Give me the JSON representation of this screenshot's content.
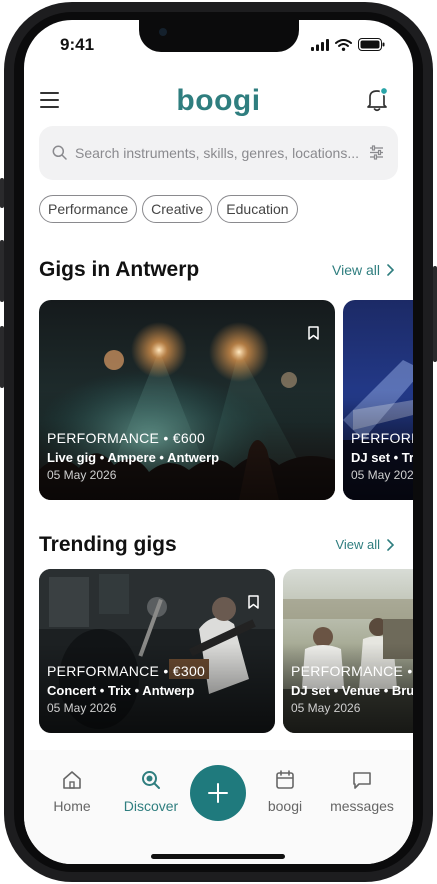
{
  "status_bar": {
    "time": "9:41"
  },
  "header": {
    "logo": "boogi"
  },
  "search": {
    "placeholder": "Search instruments, skills, genres, locations..."
  },
  "chips": [
    "Performance",
    "Creative",
    "Education"
  ],
  "sections": {
    "antwerp": {
      "title": "Gigs in Antwerp",
      "view_all": "View all",
      "cards": [
        {
          "category": "PERFORMANCE • €600",
          "details": "Live gig • Ampere • Antwerp",
          "date": "05 May 2026"
        },
        {
          "category": "PERFORM",
          "details": "DJ set • Tr",
          "date": "05 May 202"
        }
      ]
    },
    "trending": {
      "title": "Trending gigs",
      "view_all": "View all",
      "cards": [
        {
          "category": "PERFORMANCE • €300",
          "details": "Concert • Trix • Antwerp",
          "date": "05 May 2026"
        },
        {
          "category": "PERFORMANCE • €",
          "details": "DJ set • Venue • Brus",
          "date": "05 May 2026"
        }
      ]
    }
  },
  "nav": {
    "items": [
      {
        "label": "Home",
        "icon": "home-icon"
      },
      {
        "label": "Discover",
        "icon": "discover-icon",
        "active": true
      },
      {
        "label": "boogi",
        "icon": "calendar-icon"
      },
      {
        "label": "messages",
        "icon": "chat-icon"
      }
    ],
    "fab_icon": "plus-icon"
  },
  "colors": {
    "accent": "#2f7e7f",
    "fab": "#1f7a7d",
    "notification_dot": "#2aa5a8"
  }
}
